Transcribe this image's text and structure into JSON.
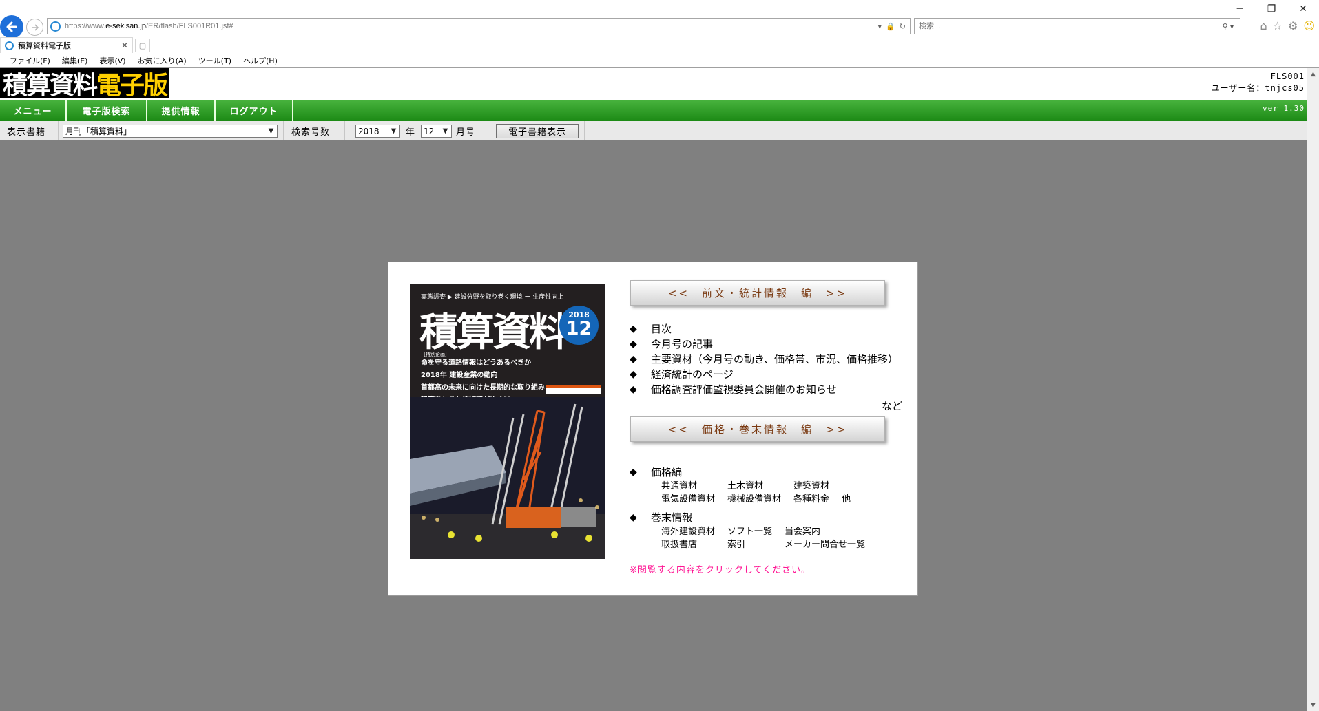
{
  "browser": {
    "url_prefix": "https://www.",
    "url_domain": "e-sekisan.jp",
    "url_path": "/ER/flash/FLS001R01.jsf#",
    "search_placeholder": "検索...",
    "tab_title": "積算資料電子版",
    "menu": [
      "ファイル(F)",
      "編集(E)",
      "表示(V)",
      "お気に入り(A)",
      "ツール(T)",
      "ヘルプ(H)"
    ],
    "window_controls": [
      "─",
      "❐",
      "✕"
    ]
  },
  "site": {
    "logo_main": "積算資料",
    "logo_accent": "電子版",
    "screen_id": "FLS001",
    "user_line": "ユーザー名：tnjcs05",
    "version": "ver 1.30",
    "nav": [
      "メニュー",
      "電子版検索",
      "提供情報",
      "ログアウト"
    ]
  },
  "filters": {
    "book_label": "表示書籍",
    "book_value": "月刊「積算資料」",
    "issue_label": "検索号数",
    "year_value": "2018",
    "year_suffix": "年",
    "month_value": "12",
    "month_suffix": "月号",
    "show_button": "電子書籍表示"
  },
  "cover": {
    "series_line": "実態調査 ▶ 建設分野を取り巻く環境 ー 生産性向上",
    "title": "積算資料",
    "issue_year": "2018",
    "issue_month": "12",
    "headline_tag": "［特別企画］",
    "headlines": [
      "命を守る道路情報はどうあるべきか",
      "2018年 建設産業の動向",
      "首都高の未来に向けた長期的な取り組み",
      "建築あれこれ技術団がゆく⑪"
    ]
  },
  "content": {
    "section1_button": "<<　前文・統計情報　編　>>",
    "section1_items": [
      "目次",
      "今月号の記事",
      "主要資材（今月号の動き、価格帯、市況、価格推移）",
      "経済統計のページ",
      "価格調査評価監視委員会開催のお知らせ"
    ],
    "etc": "など",
    "section2_button": "<<　価格・巻末情報　編　>>",
    "price_head": "価格編",
    "price_row1": [
      "共通資材",
      "土木資材",
      "建築資材"
    ],
    "price_row2": [
      "電気設備資材",
      "機械設備資材",
      "各種料金",
      "他"
    ],
    "appendix_head": "巻末情報",
    "appendix_row1": [
      "海外建設資材",
      "ソフト一覧",
      "当会案内"
    ],
    "appendix_row2": [
      "取扱書店",
      "索引",
      "メーカー問合せ一覧"
    ],
    "notice": "※閲覧する内容をクリックしてください。"
  },
  "colors": {
    "nav_green": "#2a9a22",
    "page_gray": "#808080",
    "notice_pink": "#ff1493",
    "section_text": "#7a3a12",
    "logo_accent": "#ffd000",
    "issue_badge": "#1466b8"
  }
}
